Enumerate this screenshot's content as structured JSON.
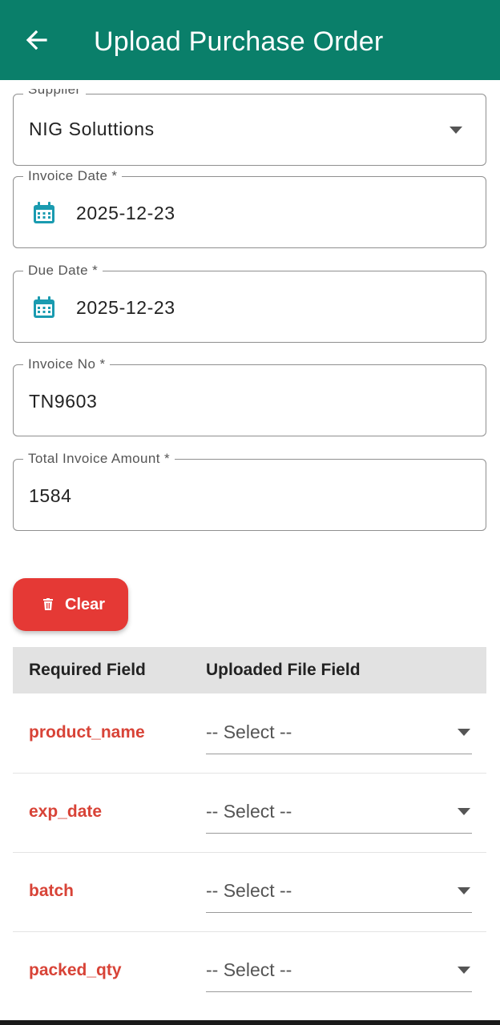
{
  "appbar": {
    "title": "Upload Purchase Order",
    "back_icon": "arrow-left-icon",
    "color": "#0a7f6a"
  },
  "form": {
    "supplier": {
      "label": "Supplier",
      "value": "NIG Soluttions"
    },
    "invoice_date": {
      "label": "Invoice Date *",
      "value": "2025-12-23",
      "icon": "calendar-icon"
    },
    "due_date": {
      "label": "Due Date *",
      "value": "2025-12-23",
      "icon": "calendar-icon"
    },
    "invoice_no": {
      "label": "Invoice No *",
      "value": "TN9603"
    },
    "total_amount": {
      "label": "Total Invoice Amount *",
      "value": "1584"
    }
  },
  "clear_button": {
    "label": "Clear",
    "icon": "trash-icon",
    "color": "#e53935"
  },
  "mapping_table": {
    "headers": [
      "Required Field",
      "Uploaded File Field"
    ],
    "rows": [
      {
        "field": "product_name",
        "selected": "-- Select --"
      },
      {
        "field": "exp_date",
        "selected": "-- Select --"
      },
      {
        "field": "batch",
        "selected": "-- Select --"
      },
      {
        "field": "packed_qty",
        "selected": "-- Select --"
      }
    ]
  },
  "colors": {
    "accent": "#0a7f6a",
    "required_field": "#d84337",
    "calendar_icon": "#1a9bb0"
  }
}
